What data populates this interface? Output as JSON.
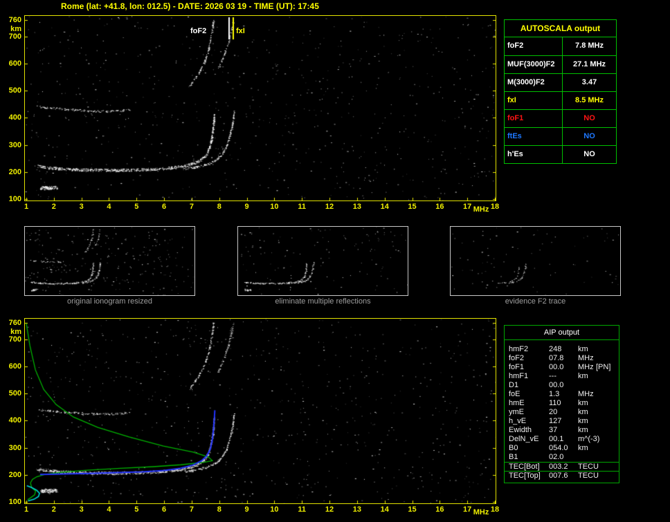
{
  "header": {
    "title": "Rome (lat: +41.8, lon: 012.5) - DATE: 2026 03 19 - TIME (UT): 17:45"
  },
  "colors": {
    "background": "#000000",
    "axis": "#f0f000",
    "plot_border": "#e3e300",
    "table_border": "#00c000",
    "caption": "#9f9f9f",
    "trace": "#ffffff",
    "profile": "#00b400",
    "fitted": "#2233ff",
    "model_e": "#00dcdc"
  },
  "autoscala_table": {
    "title": "AUTOSCALA output",
    "rows": [
      {
        "param": "foF2",
        "value": "7.8 MHz",
        "color": "#ffffff"
      },
      {
        "param": "MUF(3000)F2",
        "value": "27.1 MHz",
        "color": "#ffffff"
      },
      {
        "param": "M(3000)F2",
        "value": "3.47",
        "color": "#ffffff"
      },
      {
        "param": "fxI",
        "value": "8.5 MHz",
        "color": "#ffff00"
      },
      {
        "param": "foF1",
        "value": "NO",
        "color": "#ff1414"
      },
      {
        "param": "ftEs",
        "value": "NO",
        "color": "#1e78ff"
      },
      {
        "param": "h'Es",
        "value": "NO",
        "color": "#ffffff"
      }
    ]
  },
  "aip_table": {
    "title": "AIP output",
    "rows": [
      {
        "param": "hmF2",
        "value": "248",
        "unit": "km",
        "note": "",
        "sep": false
      },
      {
        "param": "foF2",
        "value": "07.8",
        "unit": "MHz",
        "note": "",
        "sep": false
      },
      {
        "param": "foF1",
        "value": "00.0",
        "unit": "MHz",
        "note": "[PN]",
        "sep": false
      },
      {
        "param": "hmF1",
        "value": "---",
        "unit": "km",
        "note": "",
        "sep": false
      },
      {
        "param": "D1",
        "value": "00.0",
        "unit": "",
        "note": "",
        "sep": false
      },
      {
        "param": "foE",
        "value": "1.3",
        "unit": "MHz",
        "note": "",
        "sep": false
      },
      {
        "param": "hmE",
        "value": "110",
        "unit": "km",
        "note": "",
        "sep": false
      },
      {
        "param": "ymE",
        "value": "20",
        "unit": "km",
        "note": "",
        "sep": false
      },
      {
        "param": "h_vE",
        "value": "127",
        "unit": "km",
        "note": "",
        "sep": false
      },
      {
        "param": "Ewidth",
        "value": "37",
        "unit": "km",
        "note": "",
        "sep": false
      },
      {
        "param": "DelN_vE",
        "value": "00.1",
        "unit": "m^(-3)",
        "note": "",
        "sep": false
      },
      {
        "param": "B0",
        "value": "054.0",
        "unit": "km",
        "note": "",
        "sep": false
      },
      {
        "param": "B1",
        "value": "02.0",
        "unit": "",
        "note": "",
        "sep": false
      },
      {
        "param": "TEC[Bot]",
        "value": "003.2",
        "unit": "TECU",
        "note": "",
        "sep": true
      },
      {
        "param": "TEC[Top]",
        "value": "007.6",
        "unit": "TECU",
        "note": "",
        "sep": true
      }
    ]
  },
  "thumbnails": [
    {
      "caption": "original ionogram resized"
    },
    {
      "caption": "eliminate multiple reflections"
    },
    {
      "caption": "evidence F2 trace"
    }
  ],
  "chart_data": {
    "type": "scatter",
    "title": "Rome ionogram with AUTOSCALA interpretation",
    "x_axis": {
      "label": "MHz",
      "min": 1,
      "max": 18,
      "ticks": [
        1,
        2,
        3,
        4,
        5,
        6,
        7,
        8,
        9,
        10,
        11,
        12,
        13,
        14,
        15,
        16,
        17,
        18
      ]
    },
    "y_axis": {
      "label": "km",
      "min": 100,
      "max": 760,
      "ticks": [
        760,
        700,
        600,
        500,
        400,
        300,
        200,
        100
      ]
    },
    "markers": [
      {
        "label": "foF2",
        "line_freq": 8.35,
        "scaled_mhz": 7.8,
        "color": "#ffffff"
      },
      {
        "label": "fxI",
        "line_freq": 8.5,
        "scaled_mhz": 8.5,
        "color": "#ffff00"
      }
    ],
    "traces": {
      "f_layer_o": {
        "points": [
          [
            1.4,
            222
          ],
          [
            2.2,
            212
          ],
          [
            3.2,
            208
          ],
          [
            4.2,
            207
          ],
          [
            5.2,
            209
          ],
          [
            6.0,
            213
          ],
          [
            6.6,
            220
          ],
          [
            7.0,
            230
          ],
          [
            7.3,
            243
          ],
          [
            7.5,
            261
          ],
          [
            7.62,
            286
          ],
          [
            7.7,
            316
          ],
          [
            7.76,
            353
          ],
          [
            7.8,
            393
          ],
          [
            7.81,
            412
          ]
        ],
        "thickness": 4,
        "density": 2.4
      },
      "f_layer_x": {
        "points": [
          [
            6.7,
            212
          ],
          [
            7.2,
            219
          ],
          [
            7.6,
            231
          ],
          [
            7.9,
            247
          ],
          [
            8.1,
            266
          ],
          [
            8.25,
            293
          ],
          [
            8.35,
            326
          ],
          [
            8.45,
            365
          ],
          [
            8.51,
            403
          ],
          [
            8.53,
            425
          ]
        ],
        "thickness": 3,
        "density": 1.7
      },
      "second_hop_low": {
        "points": [
          [
            1.45,
            441
          ],
          [
            2.2,
            433
          ],
          [
            3.0,
            427
          ],
          [
            3.8,
            424
          ],
          [
            4.4,
            426
          ],
          [
            4.75,
            431
          ]
        ],
        "thickness": 3,
        "density": 1.0
      },
      "second_hop_f2_o": {
        "points": [
          [
            6.9,
            515
          ],
          [
            7.2,
            558
          ],
          [
            7.45,
            604
          ],
          [
            7.6,
            650
          ],
          [
            7.7,
            700
          ],
          [
            7.76,
            744
          ],
          [
            7.79,
            762
          ]
        ],
        "thickness": 2,
        "density": 1.2
      },
      "second_hop_f2_x": {
        "points": [
          [
            7.95,
            580
          ],
          [
            8.15,
            628
          ],
          [
            8.32,
            678
          ],
          [
            8.44,
            728
          ],
          [
            8.51,
            760
          ]
        ],
        "thickness": 2,
        "density": 0.9
      },
      "transmitter_artifact": {
        "points": [
          [
            1.5,
            141
          ],
          [
            2.1,
            143
          ]
        ],
        "thickness": 5,
        "density": 5.0
      },
      "f2_evidence": {
        "points": [
          [
            5.6,
            210
          ],
          [
            6.2,
            215
          ],
          [
            6.7,
            222
          ],
          [
            7.1,
            233
          ],
          [
            7.35,
            247
          ],
          [
            7.55,
            266
          ],
          [
            7.65,
            292
          ],
          [
            7.72,
            320
          ],
          [
            7.77,
            356
          ],
          [
            7.8,
            394
          ]
        ],
        "thickness": 3,
        "density": 1.3
      }
    },
    "profile_green": [
      [
        1.0,
        758
      ],
      [
        1.13,
        676
      ],
      [
        1.33,
        587
      ],
      [
        1.63,
        515
      ],
      [
        2.08,
        459
      ],
      [
        2.71,
        413
      ],
      [
        3.59,
        375
      ],
      [
        4.72,
        340
      ],
      [
        5.97,
        306
      ],
      [
        7.05,
        284
      ],
      [
        7.6,
        266
      ],
      [
        7.75,
        252
      ],
      [
        7.45,
        246
      ],
      [
        6.6,
        237
      ],
      [
        5.6,
        230
      ],
      [
        4.4,
        224
      ],
      [
        3.2,
        217
      ],
      [
        2.33,
        210
      ],
      [
        1.7,
        202
      ],
      [
        1.38,
        193
      ],
      [
        1.22,
        183
      ],
      [
        1.15,
        170
      ],
      [
        1.2,
        152
      ],
      [
        1.34,
        140
      ],
      [
        1.3,
        126
      ],
      [
        1.15,
        115
      ],
      [
        1.05,
        108
      ]
    ],
    "fitted_blue": [
      [
        1.5,
        201
      ],
      [
        2.4,
        203
      ],
      [
        3.3,
        205
      ],
      [
        4.3,
        208
      ],
      [
        5.2,
        211
      ],
      [
        6.0,
        216
      ],
      [
        6.6,
        224
      ],
      [
        7.05,
        236
      ],
      [
        7.35,
        251
      ],
      [
        7.55,
        270
      ],
      [
        7.68,
        296
      ],
      [
        7.75,
        330
      ],
      [
        7.79,
        368
      ],
      [
        7.82,
        405
      ],
      [
        7.84,
        438
      ]
    ],
    "model_cyan": [
      [
        1.02,
        160
      ],
      [
        1.2,
        153
      ],
      [
        1.38,
        143
      ],
      [
        1.48,
        132
      ],
      [
        1.44,
        120
      ],
      [
        1.28,
        110
      ],
      [
        1.06,
        104
      ]
    ]
  }
}
